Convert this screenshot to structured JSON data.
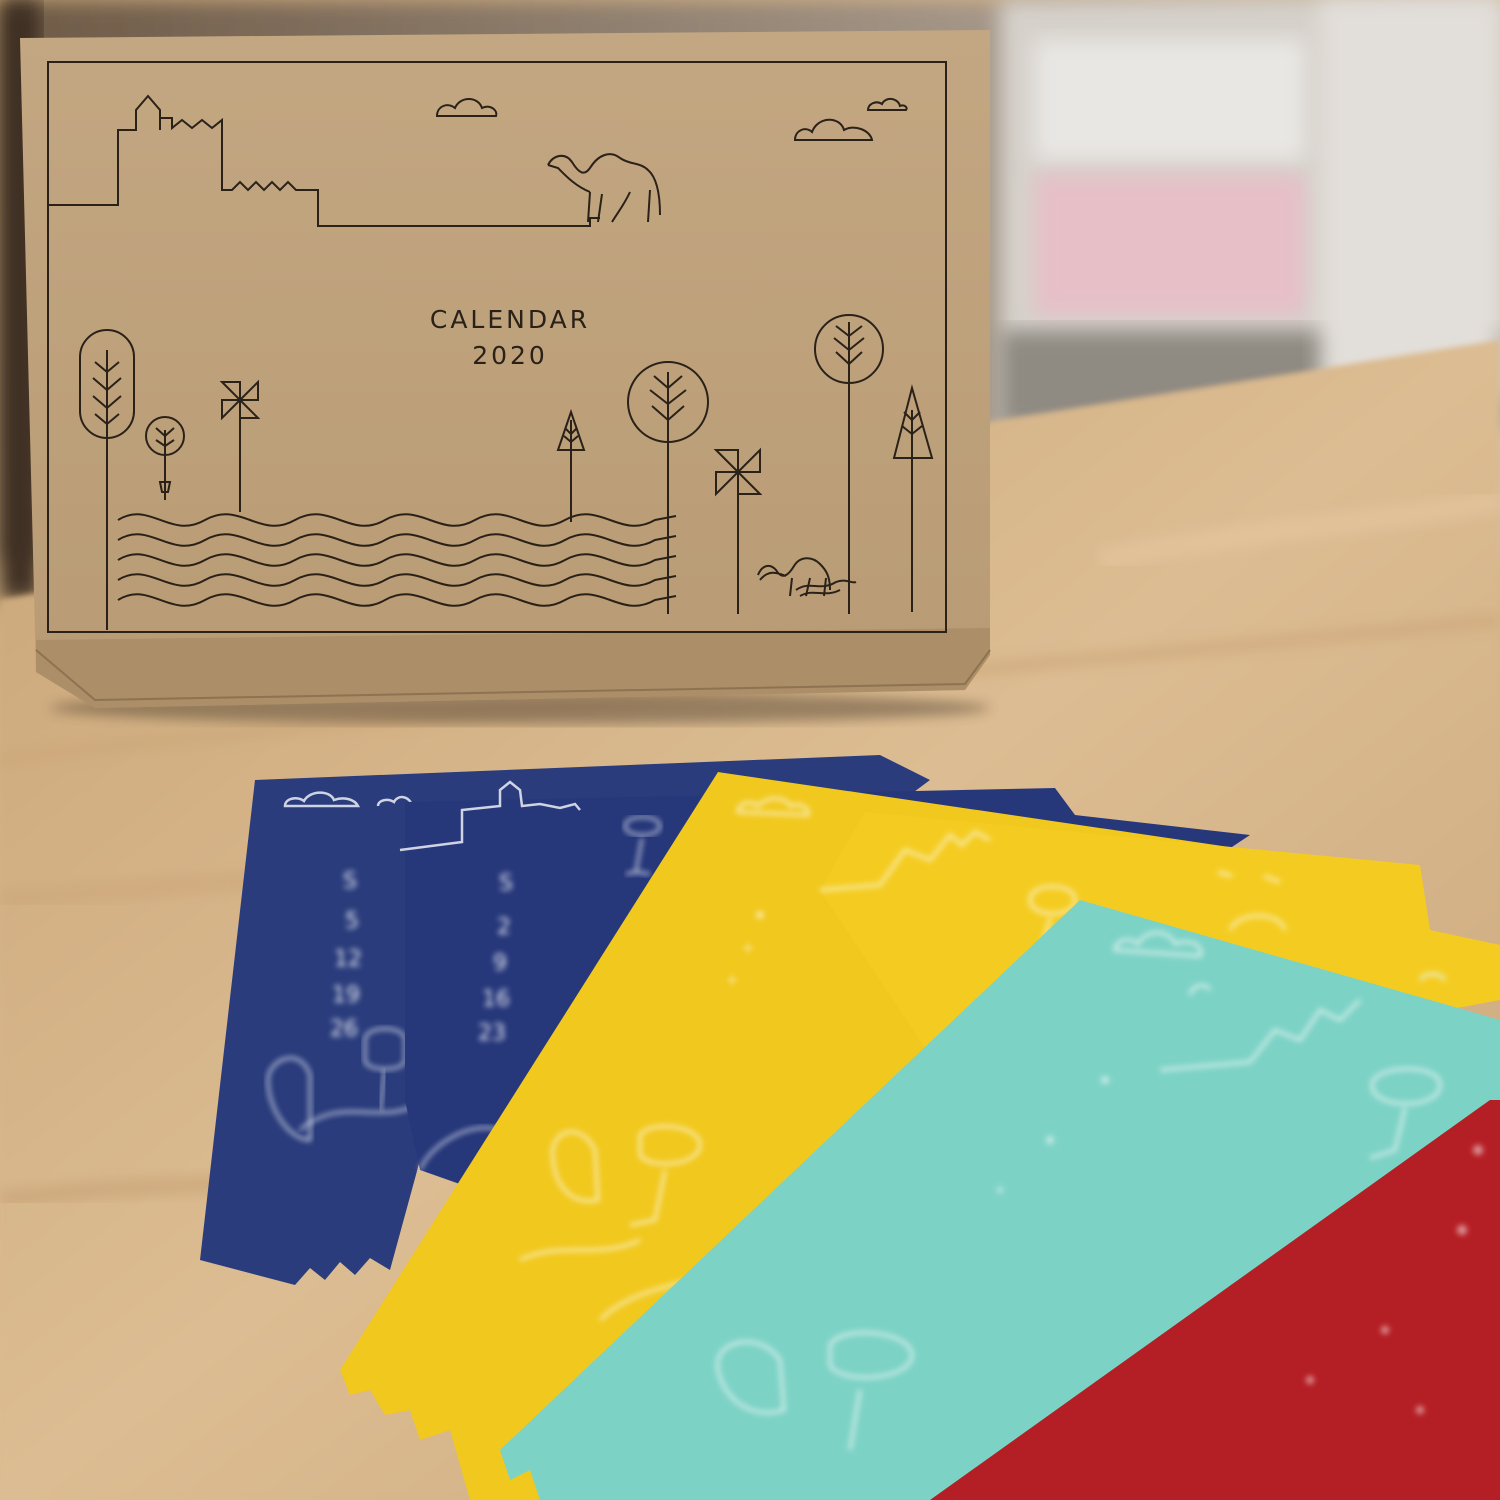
{
  "box": {
    "title_line1": "CALENDAR",
    "title_line2": "2020"
  },
  "cards": [
    {
      "color": "navy",
      "digits": [
        "S",
        "5",
        "12",
        "19",
        "26"
      ]
    },
    {
      "color": "navy",
      "digits": [
        "S",
        "2",
        "9",
        "16",
        "23"
      ]
    },
    {
      "color": "yellow",
      "digits": []
    },
    {
      "color": "yellow",
      "digits": []
    },
    {
      "color": "teal",
      "digits": []
    },
    {
      "color": "red",
      "digits": []
    }
  ],
  "palette": {
    "kraft": "#c2a57e",
    "ink": "#2a2118",
    "navy": "#2a3c7c",
    "yellow": "#f3cb1f",
    "teal": "#80d3c8",
    "red": "#b51e24",
    "table": "#d8b78d"
  }
}
